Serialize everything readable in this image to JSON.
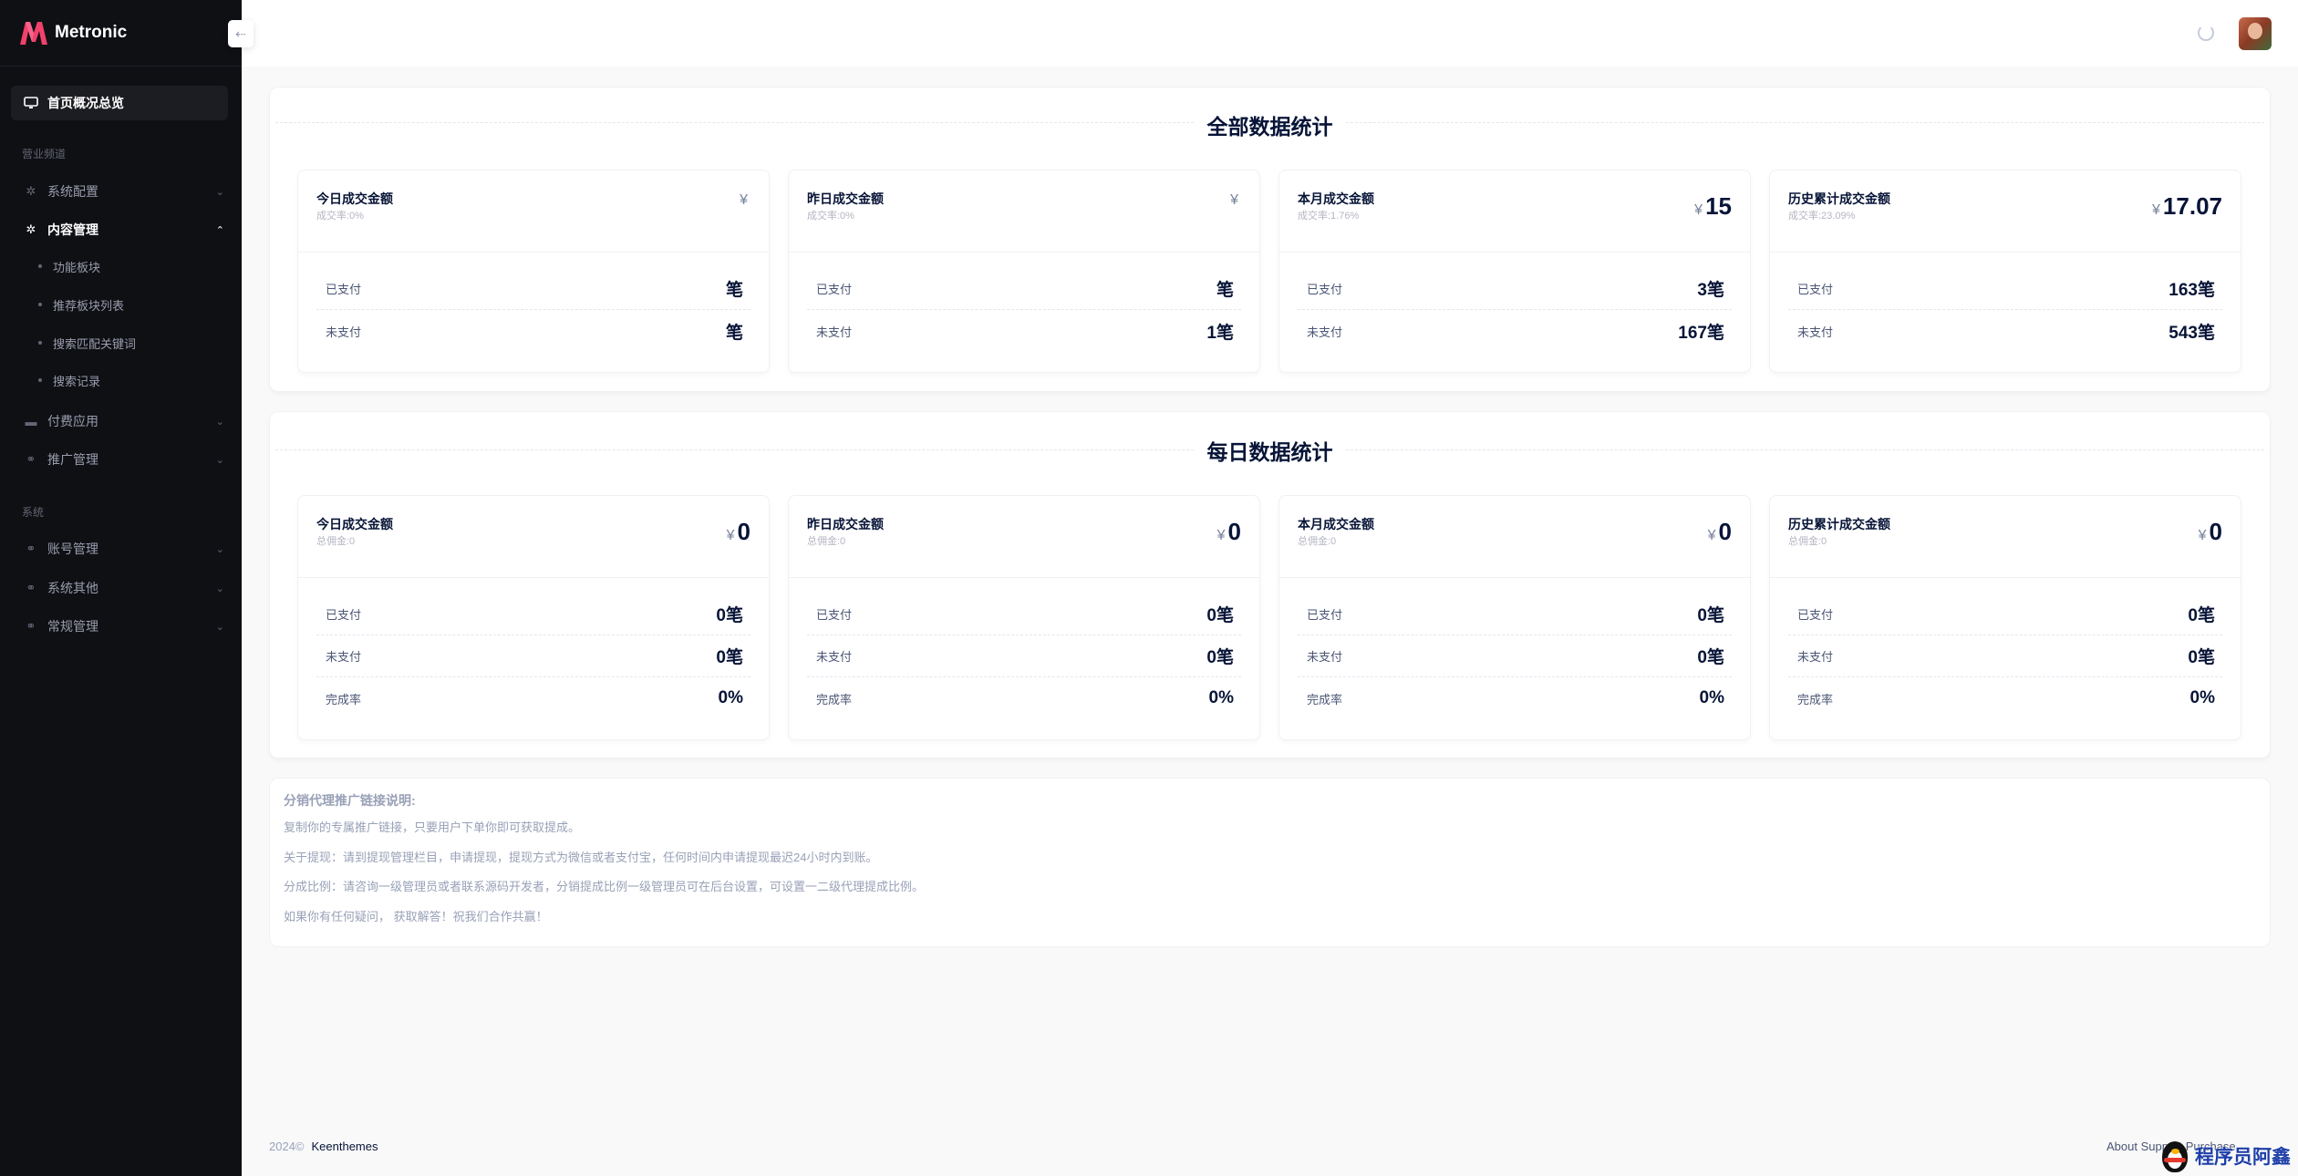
{
  "app": {
    "name": "Metronic"
  },
  "sidebar": {
    "active_item": "首页概况总览",
    "section_business": "营业频道",
    "section_system": "系统",
    "items": [
      {
        "label": "系统配置",
        "icon": "gear-icon"
      },
      {
        "label": "内容管理",
        "icon": "gear-icon",
        "open": true,
        "children": [
          "功能板块",
          "推荐板块列表",
          "搜索匹配关键词",
          "搜索记录"
        ]
      },
      {
        "label": "付费应用",
        "icon": "wallet-icon"
      },
      {
        "label": "推广管理",
        "icon": "link-icon"
      }
    ],
    "system_items": [
      {
        "label": "账号管理",
        "icon": "link-icon"
      },
      {
        "label": "系统其他",
        "icon": "link-icon"
      },
      {
        "label": "常规管理",
        "icon": "link-icon"
      }
    ]
  },
  "header": {
    "collapse_icon": "arrow-left-icon"
  },
  "overall": {
    "title": "全部数据统计",
    "cards": [
      {
        "title": "今日成交金额",
        "sub": "成交率:0%",
        "currency": "¥",
        "amount": "",
        "rows": [
          {
            "k": "已支付",
            "v": "笔"
          },
          {
            "k": "未支付",
            "v": "笔"
          }
        ]
      },
      {
        "title": "昨日成交金额",
        "sub": "成交率:0%",
        "currency": "¥",
        "amount": "",
        "rows": [
          {
            "k": "已支付",
            "v": "笔"
          },
          {
            "k": "未支付",
            "v": "1笔"
          }
        ]
      },
      {
        "title": "本月成交金额",
        "sub": "成交率:1.76%",
        "currency": "¥",
        "amount": "15",
        "rows": [
          {
            "k": "已支付",
            "v": "3笔"
          },
          {
            "k": "未支付",
            "v": "167笔"
          }
        ]
      },
      {
        "title": "历史累计成交金额",
        "sub": "成交率:23.09%",
        "currency": "¥",
        "amount": "17.07",
        "rows": [
          {
            "k": "已支付",
            "v": "163笔"
          },
          {
            "k": "未支付",
            "v": "543笔"
          }
        ]
      }
    ]
  },
  "daily": {
    "title": "每日数据统计",
    "cards": [
      {
        "title": "今日成交金额",
        "sub": "总佣金:0",
        "currency": "¥",
        "amount": "0",
        "rows": [
          {
            "k": "已支付",
            "v": "0笔"
          },
          {
            "k": "未支付",
            "v": "0笔"
          },
          {
            "k": "完成率",
            "v": "0%"
          }
        ]
      },
      {
        "title": "昨日成交金额",
        "sub": "总佣金:0",
        "currency": "¥",
        "amount": "0",
        "rows": [
          {
            "k": "已支付",
            "v": "0笔"
          },
          {
            "k": "未支付",
            "v": "0笔"
          },
          {
            "k": "完成率",
            "v": "0%"
          }
        ]
      },
      {
        "title": "本月成交金额",
        "sub": "总佣金:0",
        "currency": "¥",
        "amount": "0",
        "rows": [
          {
            "k": "已支付",
            "v": "0笔"
          },
          {
            "k": "未支付",
            "v": "0笔"
          },
          {
            "k": "完成率",
            "v": "0%"
          }
        ]
      },
      {
        "title": "历史累计成交金额",
        "sub": "总佣金:0",
        "currency": "¥",
        "amount": "0",
        "rows": [
          {
            "k": "已支付",
            "v": "0笔"
          },
          {
            "k": "未支付",
            "v": "0笔"
          },
          {
            "k": "完成率",
            "v": "0%"
          }
        ]
      }
    ]
  },
  "notes": {
    "title": "分销代理推广链接说明:",
    "lines": [
      "复制你的专属推广链接，只要用户下单你即可获取提成。",
      "关于提现：请到提现管理栏目，申请提现，提现方式为微信或者支付宝，任何时间内申请提现最迟24小时内到账。",
      "分成比例：请咨询一级管理员或者联系源码开发者，分销提成比例一级管理员可在后台设置，可设置一二级代理提成比例。",
      "如果你有任何疑问， 获取解答！祝我们合作共赢！"
    ]
  },
  "footer": {
    "year": "2024©",
    "brand": "Keenthemes",
    "links": "About   Support   Purchase"
  },
  "watermark": {
    "text": "程序员阿鑫"
  }
}
